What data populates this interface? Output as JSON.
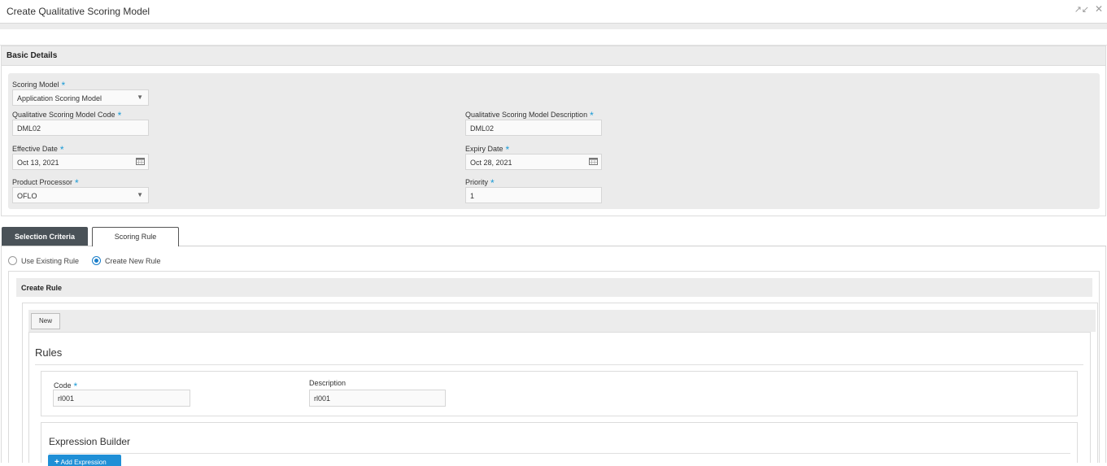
{
  "window": {
    "title": "Create Qualitative Scoring Model"
  },
  "basic_details": {
    "header": "Basic Details",
    "scoring_model": {
      "label": "Scoring Model",
      "value": "Application Scoring Model"
    },
    "model_code": {
      "label": "Qualitative Scoring Model Code",
      "value": "DML02"
    },
    "model_description": {
      "label": "Qualitative Scoring Model Description",
      "value": "DML02"
    },
    "effective_date": {
      "label": "Effective Date",
      "value": "Oct 13, 2021"
    },
    "expiry_date": {
      "label": "Expiry Date",
      "value": "Oct 28, 2021"
    },
    "product_processor": {
      "label": "Product Processor",
      "value": "OFLO"
    },
    "priority": {
      "label": "Priority",
      "value": "1"
    },
    "required_mark": "*"
  },
  "tabs": [
    {
      "label": "Selection Criteria",
      "active": true
    },
    {
      "label": "Scoring Rule",
      "active": false
    }
  ],
  "rule_options": {
    "use_existing": {
      "label": "Use Existing Rule",
      "selected": false
    },
    "create_new": {
      "label": "Create New Rule",
      "selected": true
    }
  },
  "create_rule": {
    "header": "Create Rule",
    "new_button": "New",
    "rules_title": "Rules",
    "code": {
      "label": "Code",
      "value": "rl001"
    },
    "description": {
      "label": "Description",
      "value": "rl001"
    },
    "expression_builder_title": "Expression Builder",
    "add_expression_button": "Add Expression"
  },
  "colors": {
    "accent": "#1a9ad6",
    "active_tab": "#4a5258",
    "primary_button": "#1f8fd6"
  }
}
